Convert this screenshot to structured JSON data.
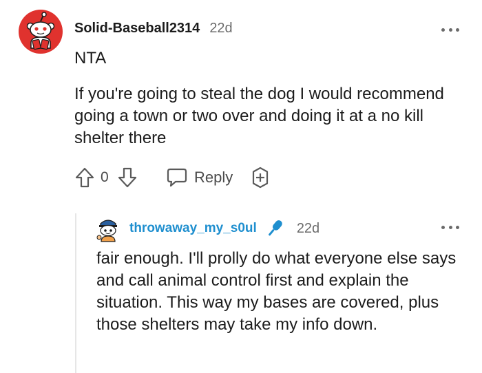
{
  "comment": {
    "username": "Solid-Baseball2314",
    "timestamp": "22d",
    "verdict": "NTA",
    "body": "If you're going to steal the dog I would recommend going a town or two over and doing it at a no kill shelter there",
    "score": "0",
    "reply_label": "Reply",
    "avatar": "snoo-avatar-red-icon",
    "menu_icon": "more-options-icon"
  },
  "reply": {
    "username": "throwaway_my_s0ul",
    "flair_icon": "microphone-icon",
    "timestamp": "22d",
    "body": "fair enough. I'll prolly do what everyone else says and call animal control first and explain the situation. This way my bases are covered, plus those shelters may take my info down.",
    "avatar": "snoo-avatar-blue-icon",
    "menu_icon": "more-options-icon"
  },
  "colors": {
    "reply_username": "#1f8fcf",
    "text": "#1c1c1c",
    "meta": "#6b6b6b",
    "avatar_red": "#e0322e"
  }
}
